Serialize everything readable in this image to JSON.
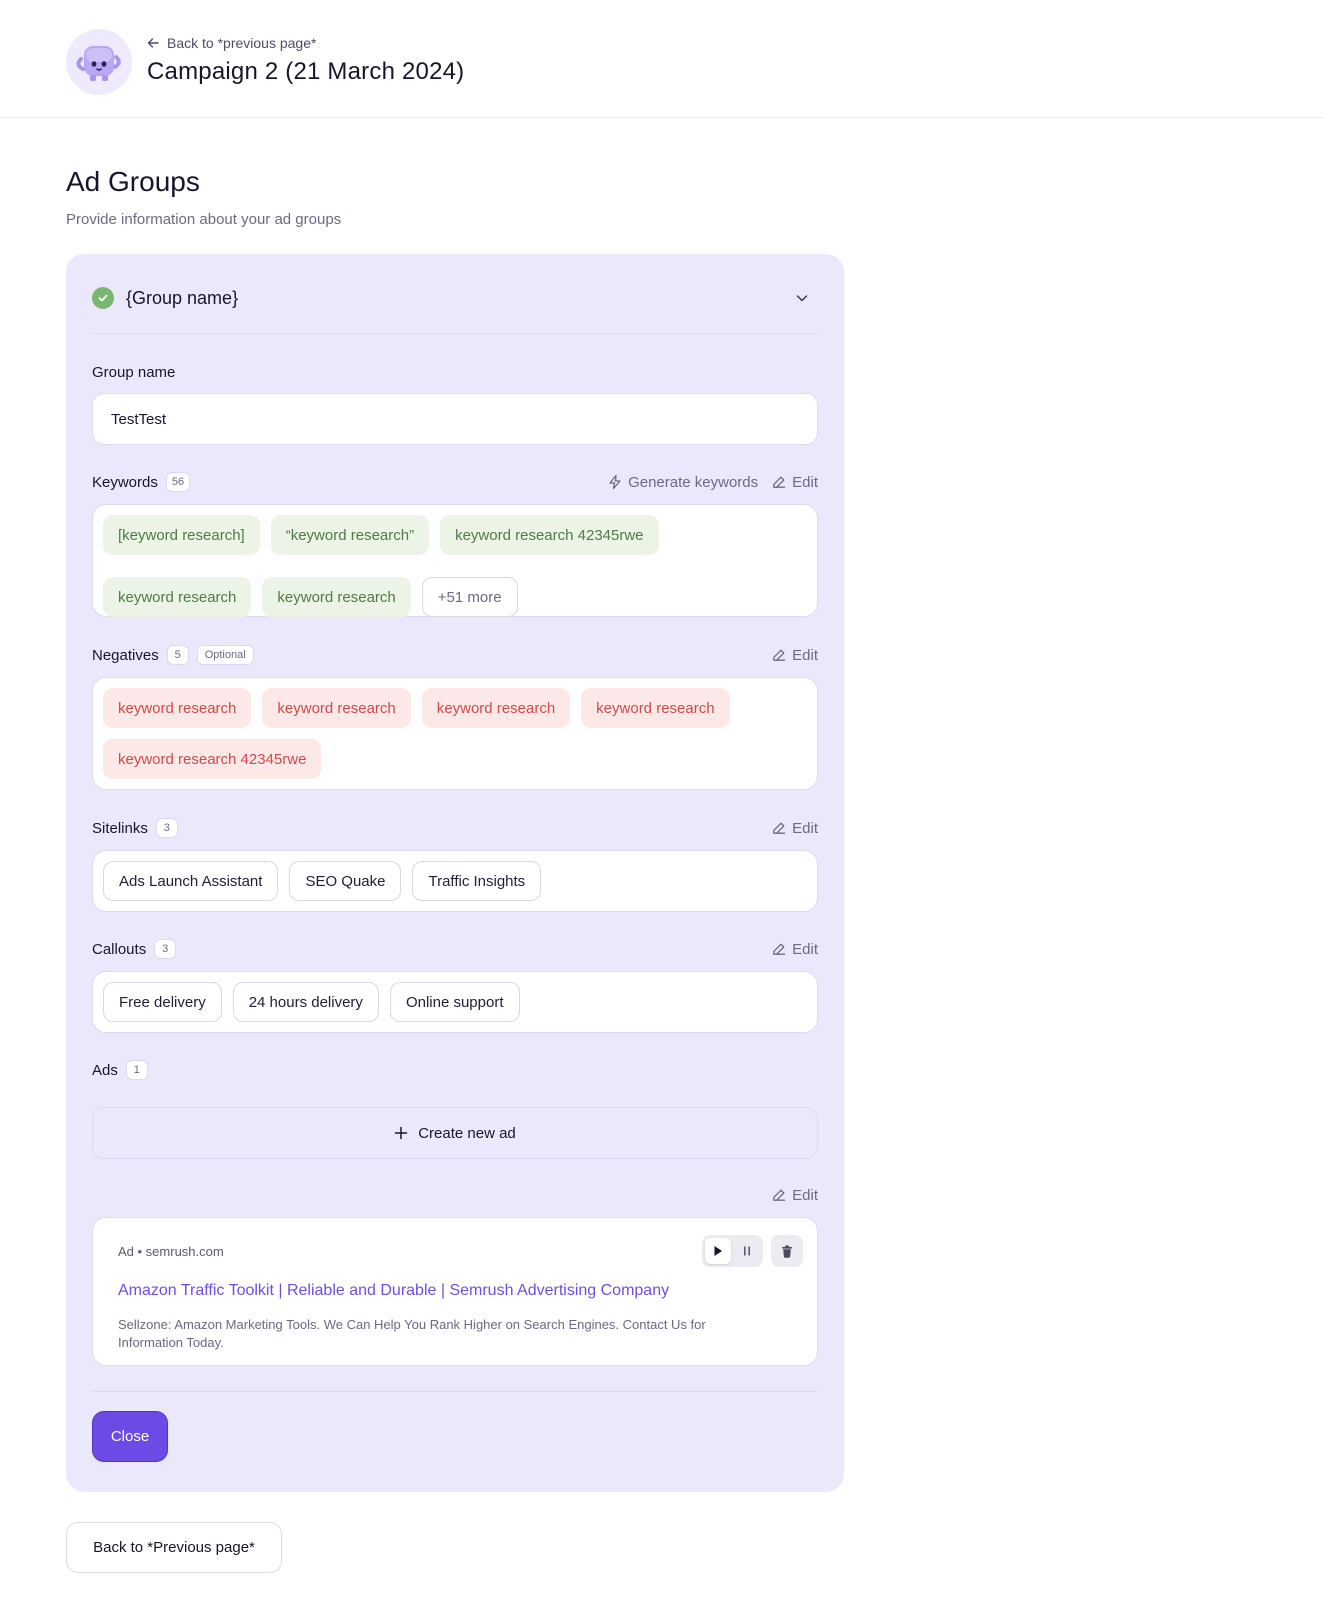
{
  "header": {
    "back_link": "Back to *previous page*",
    "title": "Campaign 2 (21 March 2024)"
  },
  "section": {
    "title": "Ad Groups",
    "subtitle": "Provide information about your ad groups"
  },
  "group": {
    "title": "{Group name}",
    "group_name_label": "Group name",
    "group_name_value": "TestTest",
    "keywords": {
      "label": "Keywords",
      "count": "56",
      "generate": "Generate keywords",
      "edit": "Edit",
      "items": [
        "[keyword research]",
        "“keyword research”",
        "keyword research 42345rwe",
        "keyword research",
        "keyword research"
      ],
      "more": "+51 more"
    },
    "negatives": {
      "label": "Negatives",
      "count": "5",
      "optional": "Optional",
      "edit": "Edit",
      "items": [
        "keyword research",
        "keyword research",
        "keyword research",
        "keyword research",
        "keyword research 42345rwe"
      ]
    },
    "sitelinks": {
      "label": "Sitelinks",
      "count": "3",
      "edit": "Edit",
      "items": [
        "Ads Launch Assistant",
        "SEO Quake",
        "Traffic Insights"
      ]
    },
    "callouts": {
      "label": "Callouts",
      "count": "3",
      "edit": "Edit",
      "items": [
        "Free delivery",
        "24 hours delivery",
        "Online support"
      ]
    },
    "ads": {
      "label": "Ads",
      "count": "1",
      "create": "Create new ad",
      "edit": "Edit",
      "ad": {
        "meta": "Ad • semrush.com",
        "headline": "Amazon Traffic Toolkit | Reliable and Durable | Semrush Advertising Company",
        "description": "Sellzone: Amazon Marketing Tools. We Can Help You Rank Higher on Search Engines. Contact Us for Information Today."
      }
    },
    "close": "Close"
  },
  "footer": {
    "back_button": "Back to *Previous page*"
  },
  "colors": {
    "accent": "#6c4ae6",
    "card_bg": "#ece8fc",
    "success": "#79b76f",
    "keyword_bg": "#ebf4e6",
    "negative_bg": "#fde8e8"
  }
}
